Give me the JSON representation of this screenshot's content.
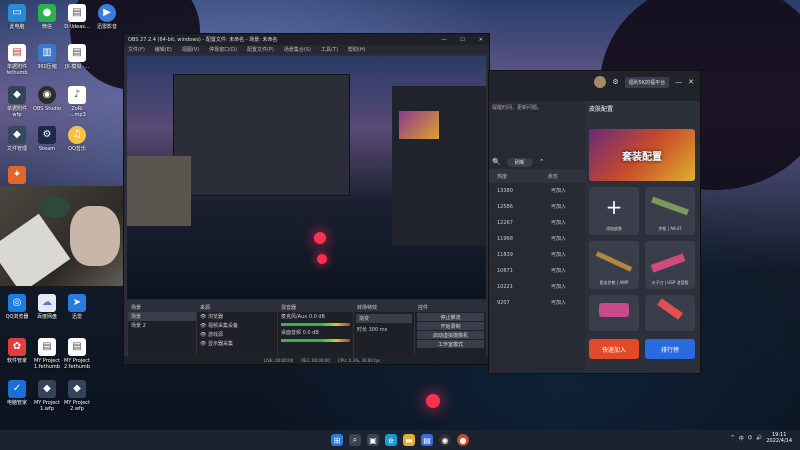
{
  "desktop": {
    "icons_col1": [
      "此电脑",
      "单据附件 fethumb",
      "单据附件 wfp",
      "文件管理",
      "迅雷",
      "QQ浏览器",
      "软件管家",
      "电脑管家"
    ],
    "icons_col2": [
      "微信",
      "360压缩",
      "OBS Studio",
      "Steam",
      "酷狗",
      "百度网盘",
      "MY Project 1.fethumb",
      "MY Project 1.wfp"
    ],
    "icons_col3": [
      "D:\\Ideas...",
      "JX·模拟 ·...",
      "ZoRi ·...mp3",
      "QQ音乐",
      "",
      "迅雷",
      "MY Project 2.fethumb",
      "MY Project 2.wfp"
    ],
    "icons_col4": [
      "迅雷影音"
    ]
  },
  "obs": {
    "title": "OBS 27.2.4 (64-bit, windows) - 配置文件: 未命名 - 场景: 未命名",
    "menu": [
      "文件(F)",
      "编辑(E)",
      "视图(V)",
      "停靠窗口(D)",
      "配置文件(P)",
      "场景集合(S)",
      "工具(T)",
      "帮助(H)"
    ],
    "scenes_header": "场景",
    "scenes": [
      "场景",
      "场景 2"
    ],
    "sources_header": "来源",
    "sources": [
      "浏览器",
      "视频采集设备",
      "游戏源",
      "显示器采集"
    ],
    "mixer_header": "混音器",
    "mixer": [
      {
        "name": "桌面音频",
        "level": "0.0 dB"
      },
      {
        "name": "麦克风/Aux",
        "level": "0.0 dB"
      }
    ],
    "transition_header": "转场特效",
    "transition_value": "渐变",
    "duration_label": "时长",
    "duration_value": "300 ms",
    "controls_header": "控件",
    "controls": [
      "停止推流",
      "开始录制",
      "启动虚拟摄像机",
      "工作室模式",
      "设置",
      "退出"
    ],
    "status": {
      "dropped": "丢帧 0 (0.0%)",
      "live": "LIVE: 00:00:00",
      "rec": "REC: 00:00:00",
      "cpu": "CPU: 0.3%, 30.00 fps",
      "delay": "延迟 (现: 300 秒/升级)"
    }
  },
  "game": {
    "brand_button": "福利5K的福平台",
    "section_title": "皮肤配置",
    "banner_text": "套装配置",
    "hint_text": "提醒时间，更新问题。",
    "table_header": {
      "col1": "热度",
      "col2": "状态"
    },
    "search_button": "刷新",
    "rows": [
      {
        "heat": "13380",
        "status": "可加入"
      },
      {
        "heat": "12586",
        "status": "可加入"
      },
      {
        "heat": "12267",
        "status": "可加入"
      },
      {
        "heat": "11968",
        "status": "可加入"
      },
      {
        "heat": "11839",
        "status": "可加入"
      },
      {
        "heat": "10871",
        "status": "可加入"
      },
      {
        "heat": "10221",
        "status": "可加入"
      },
      {
        "heat": "9207",
        "status": "可加入"
      },
      {
        "heat": "",
        "status": "可加入"
      }
    ],
    "cards": [
      {
        "label": "添加皮肤"
      },
      {
        "label": "步枪 | AK-47"
      },
      {
        "label": "狙击步枪 | AWP"
      },
      {
        "label": "爪子刀 | USP 消音版"
      },
      {
        "label": ""
      },
      {
        "label": ""
      }
    ],
    "join_button": "快速加入",
    "rank_button": "排行榜"
  },
  "taskbar": {
    "time": "19:11",
    "date": "2022/4/14",
    "ime": "中",
    "accent": "#0078d4"
  }
}
